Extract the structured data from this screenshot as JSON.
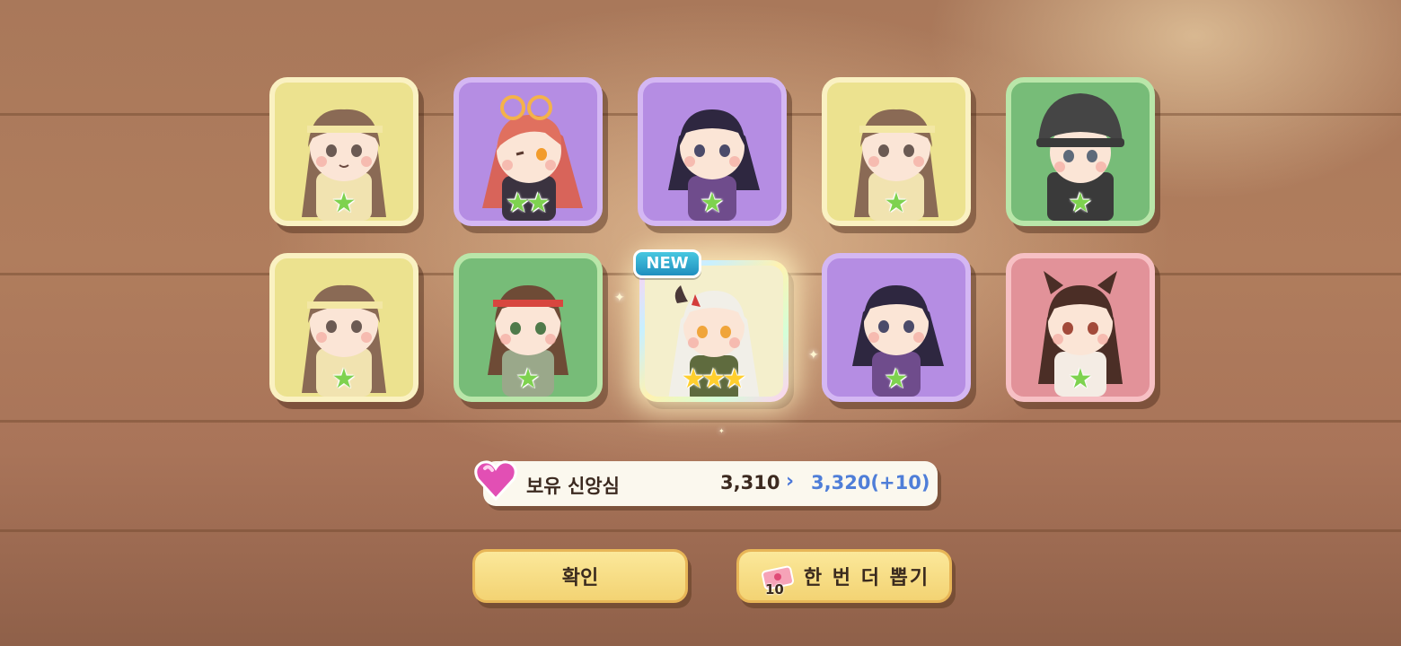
{
  "cards": [
    {
      "frame": "yellow",
      "stars": 1
    },
    {
      "frame": "purple",
      "stars": 2
    },
    {
      "frame": "purple",
      "stars": 1
    },
    {
      "frame": "yellow",
      "stars": 1
    },
    {
      "frame": "green",
      "stars": 1
    },
    {
      "frame": "yellow",
      "stars": 1
    },
    {
      "frame": "green",
      "stars": 1
    },
    {
      "frame": "rainbow",
      "stars": 3,
      "badge": "NEW"
    },
    {
      "frame": "purple",
      "stars": 1
    },
    {
      "frame": "pink",
      "stars": 1
    }
  ],
  "faith": {
    "icon": "heart-gem-icon",
    "label": "보유 신앙심",
    "current": "3,310",
    "arrow": "›",
    "new_value": "3,320(+10)"
  },
  "buttons": {
    "confirm_label": "확인",
    "again_label": "한 번 더 뽑기",
    "ticket_icon": "gacha-ticket-icon",
    "ticket_count": "10"
  },
  "colors": {
    "yellow": "#ece28f",
    "purple": "#b58de3",
    "green": "#77bc78",
    "pink": "#e29299",
    "star_green": "#7ed24f",
    "star_gold": "#ffcf2e",
    "accent_blue": "#4f7ed8"
  }
}
